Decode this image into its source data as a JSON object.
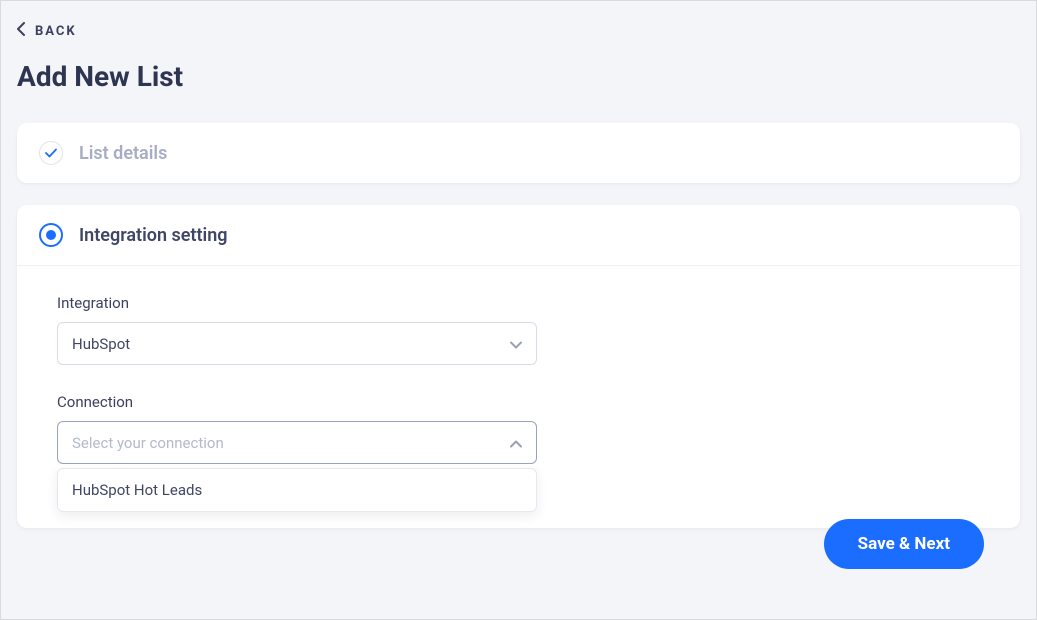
{
  "nav": {
    "back_label": "BACK"
  },
  "page": {
    "title": "Add New List"
  },
  "sections": {
    "list_details": {
      "title": "List details"
    },
    "integration_setting": {
      "title": "Integration setting",
      "integration_label": "Integration",
      "integration_value": "HubSpot",
      "connection_label": "Connection",
      "connection_placeholder": "Select your connection",
      "connection_options": [
        "HubSpot Hot Leads"
      ]
    }
  },
  "buttons": {
    "save_next": "Save & Next"
  }
}
